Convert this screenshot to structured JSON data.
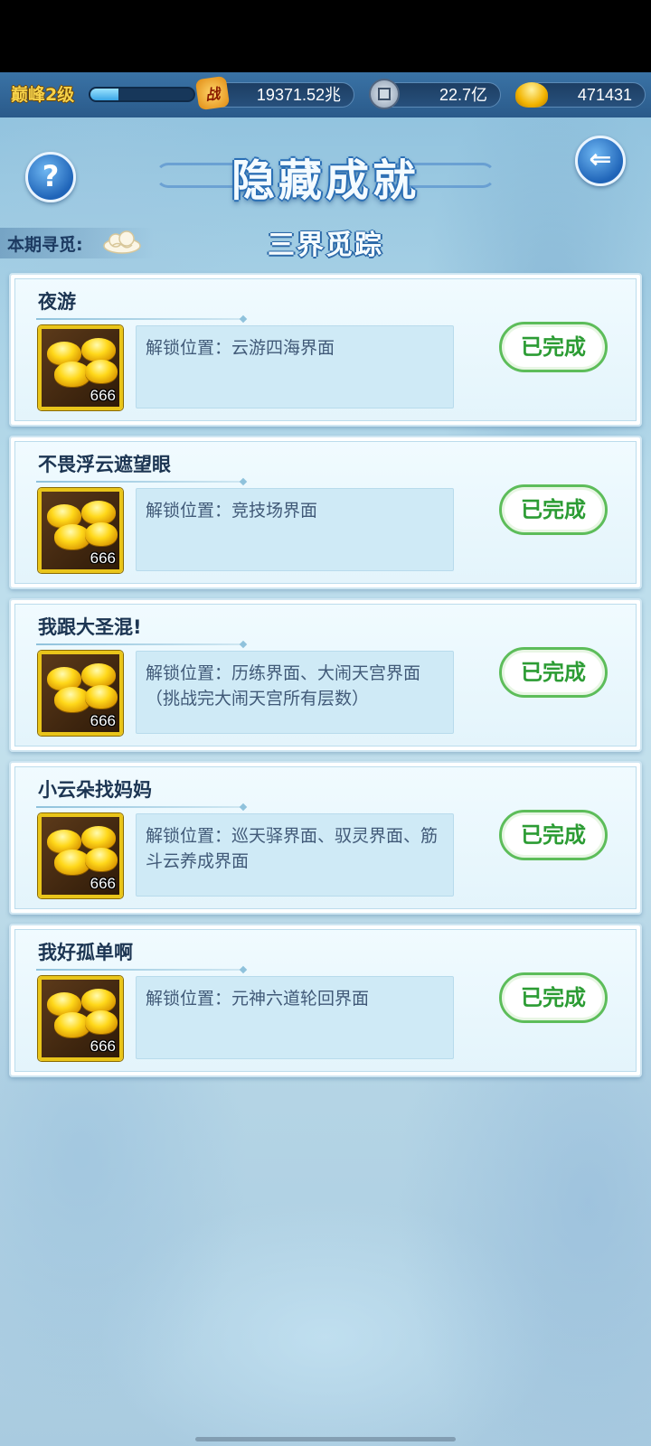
{
  "topbar": {
    "level_label": "巅峰2级",
    "level_progress": 0.27,
    "battle_power": "19371.52兆",
    "battle_icon_char": "战",
    "coins": "22.7亿",
    "ingots": "471431"
  },
  "header": {
    "title": "隐藏成就",
    "help_icon_char": "?",
    "back_icon_char": "⇐"
  },
  "period": {
    "label": "本期寻觅:",
    "name": "三界觅踪"
  },
  "achievements": [
    {
      "title": "夜游",
      "reward_qty": "666",
      "desc": "解锁位置：云游四海界面",
      "status": "已完成"
    },
    {
      "title": "不畏浮云遮望眼",
      "reward_qty": "666",
      "desc": "解锁位置：竞技场界面",
      "status": "已完成"
    },
    {
      "title": "我跟大圣混!",
      "reward_qty": "666",
      "desc": "解锁位置：历练界面、大闹天宫界面（挑战完大闹天宫所有层数）",
      "status": "已完成"
    },
    {
      "title": "小云朵找妈妈",
      "reward_qty": "666",
      "desc": "解锁位置：巡天驿界面、驭灵界面、筋斗云养成界面",
      "status": "已完成"
    },
    {
      "title": "我好孤单啊",
      "reward_qty": "666",
      "desc": "解锁位置：元神六道轮回界面",
      "status": "已完成"
    }
  ]
}
